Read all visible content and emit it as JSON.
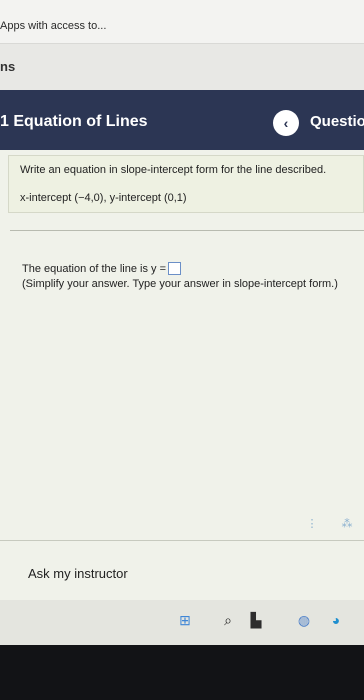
{
  "browser": {
    "bookmark_label": "Apps with access to..."
  },
  "strip": {
    "text": "ns"
  },
  "header": {
    "title": "1 Equation of Lines",
    "prev_icon": "‹",
    "question_label": "Questio"
  },
  "question": {
    "prompt": "Write an equation in slope-intercept form for the line described.",
    "intercepts": "x-intercept (−4,0), y-intercept (0,1)",
    "answer_prefix": "The equation of the line is y =",
    "instructions": "(Simplify your answer. Type your answer in slope-intercept form.)"
  },
  "tools": {
    "icon1": "⋮",
    "icon2": "⁂"
  },
  "footer": {
    "ask_label": "Ask my instructor"
  },
  "taskbar": {
    "start_icon": "⊞",
    "search_icon": "⌕",
    "files_icon": "▙",
    "chrome_icon": "◍",
    "edge_icon": "◕"
  }
}
